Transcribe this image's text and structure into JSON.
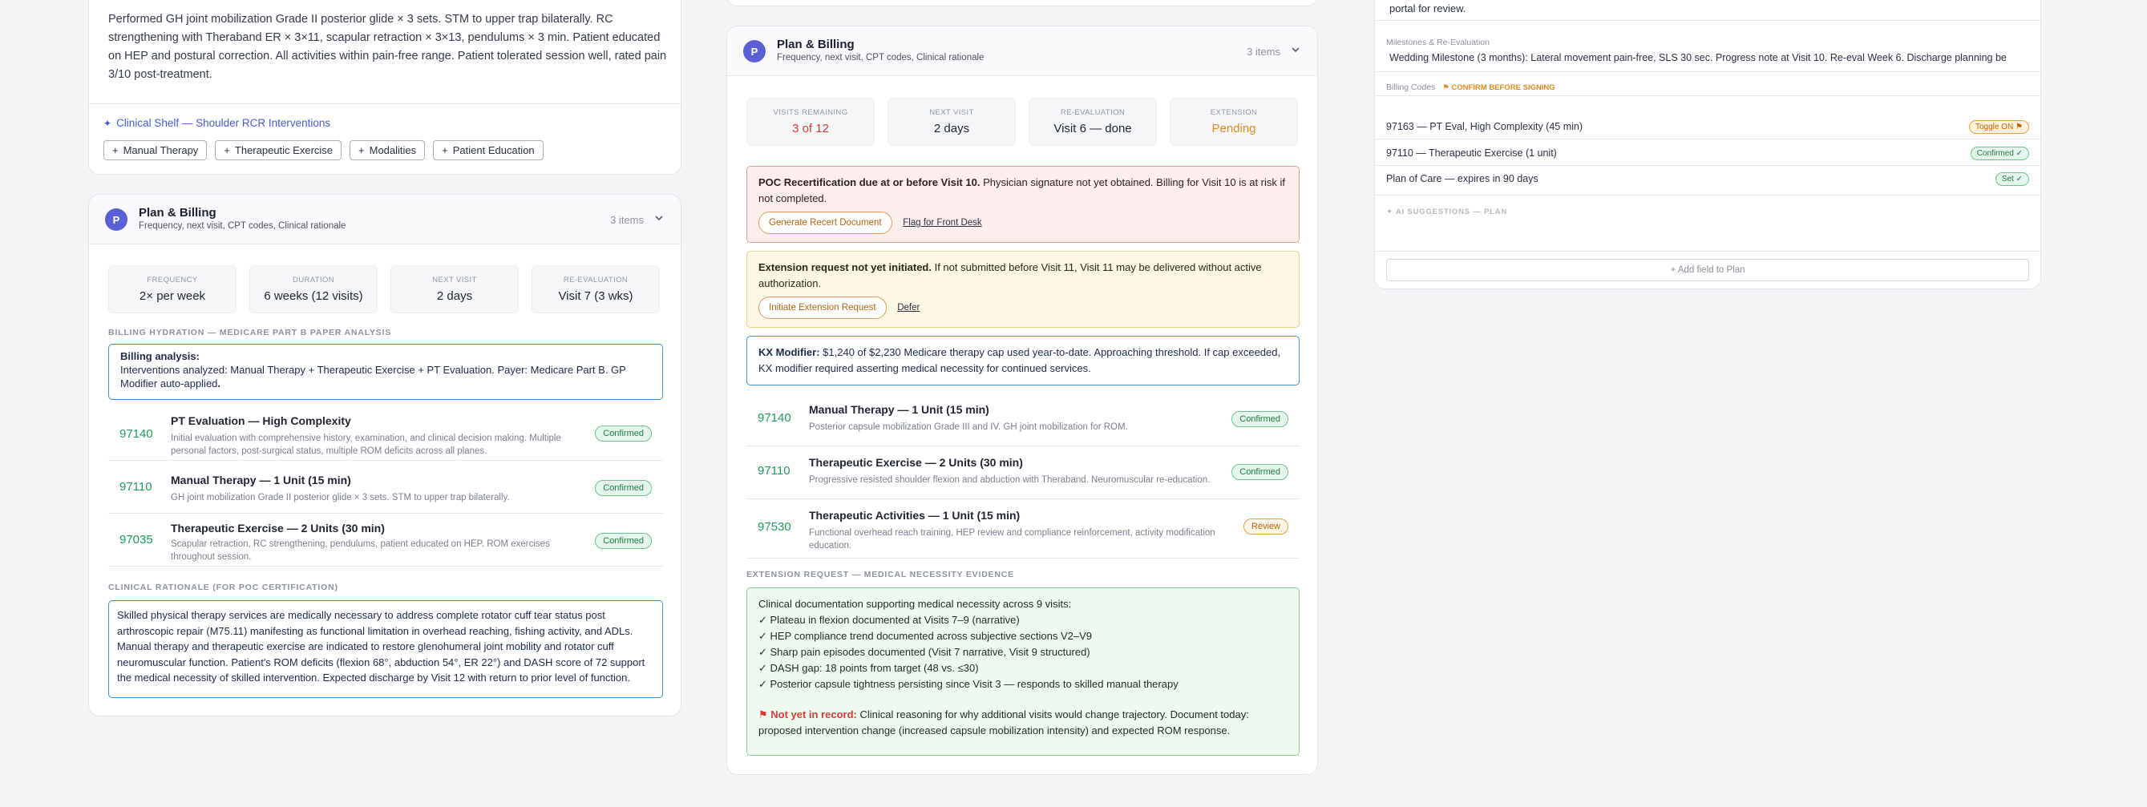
{
  "top_note": {
    "text": "Performed GH joint mobilization Grade II posterior glide × 3 sets. STM to upper trap bilaterally. RC strengthening with Theraband ER × 3×11, scapular retraction × 3×13, pendulums × 3 min. Patient educated on HEP and postural correction. All activities within pain-free range. Patient tolerated session well, rated pain 3/10 post-treatment.",
    "shelf_label": "Clinical Shelf — Shoulder RCR Interventions",
    "chips": [
      "Manual Therapy",
      "Therapeutic Exercise",
      "Modalities",
      "Patient Education"
    ]
  },
  "plan_left": {
    "avatar": "P",
    "title": "Plan & Billing",
    "subtitle": "Frequency, next visit, CPT codes, Clinical rationale",
    "count": "3 items",
    "stats": [
      {
        "label": "FREQUENCY",
        "value": "2× per week"
      },
      {
        "label": "DURATION",
        "value": "6 weeks (12 visits)"
      },
      {
        "label": "NEXT VISIT",
        "value": "2 days"
      },
      {
        "label": "RE-EVALUATION",
        "value": "Visit 7 (3 wks)"
      }
    ],
    "hydration_label": "BILLING HYDRATION — MEDICARE PART B PAPER ANALYSIS",
    "analysis_title": "Billing analysis:",
    "analysis_text": "Interventions analyzed: Manual Therapy + Therapeutic Exercise + PT Evaluation. Payer: Medicare Part B. GP Modifier auto-applied",
    "analysis_end": ".",
    "codes": [
      {
        "code": "97140",
        "title": "PT Evaluation — High Complexity",
        "desc": "Initial evaluation with comprehensive history, examination, and clinical decision making. Multiple personal factors, post-surgical status, multiple ROM deficits across all planes.",
        "status": "Confirmed"
      },
      {
        "code": "97110",
        "title": "Manual Therapy — 1 Unit (15 min)",
        "desc": "GH joint mobilization Grade II posterior glide × 3 sets. STM to upper trap bilaterally.",
        "status": "Confirmed"
      },
      {
        "code": "97035",
        "title": "Therapeutic Exercise — 2 Units (30 min)",
        "desc": "Scapular retraction, RC strengthening, pendulums, patient educated on HEP. ROM exercises throughout session.",
        "status": "Confirmed"
      }
    ],
    "rationale_label": "CLINICAL RATIONALE (FOR POC CERTIFICATION)",
    "rationale_text": "Skilled physical therapy services are medically necessary to address complete rotator cuff tear status post arthroscopic repair (M75.11) manifesting as functional limitation in overhead reaching, fishing activity, and ADLs. Manual therapy and therapeutic exercise are indicated to restore glenohumeral joint mobility and rotator cuff neuromuscular function. Patient's ROM deficits (flexion 68°, abduction 54°, ER 22°) and DASH score of 72 support the medical necessity of skilled intervention. Expected discharge by Visit 12 with return to prior level of function."
  },
  "plan_mid": {
    "avatar": "P",
    "title": "Plan & Billing",
    "subtitle": "Frequency, next visit, CPT codes, Clinical rationale",
    "count": "3 items",
    "stats": [
      {
        "label": "VISITS REMAINING",
        "value": "3 of 12"
      },
      {
        "label": "NEXT VISIT",
        "value": "2 days"
      },
      {
        "label": "RE-EVALUATION",
        "value": "Visit 6 — done"
      },
      {
        "label": "EXTENSION",
        "value": "Pending"
      }
    ],
    "poc_title": "POC Recertification due at or before Visit 10.",
    "poc_text": " Physician signature not yet obtained. Billing for Visit 10 is at risk if not completed.",
    "poc_button": "Generate Recert Document",
    "poc_link": "Flag for Front Desk",
    "ext_title": "Extension request not yet initiated.",
    "ext_text": " If not submitted before Visit 11, Visit 11 may be delivered without active authorization.",
    "ext_button": "Initiate Extension Request",
    "ext_link": "Defer",
    "kx_title": "KX Modifier:",
    "kx_text": " $1,240 of $2,230 Medicare therapy cap used year-to-date. Approaching threshold. If cap exceeded, KX modifier required asserting medical necessity for continued services.",
    "codes": [
      {
        "code": "97140",
        "title": "Manual Therapy — 1 Unit (15 min)",
        "desc": "Posterior capsule mobilization Grade III and IV. GH joint mobilization for ROM.",
        "status": "Confirmed"
      },
      {
        "code": "97110",
        "title": "Therapeutic Exercise — 2 Units (30 min)",
        "desc": "Progressive resisted shoulder flexion and abduction with Theraband. Neuromuscular re-education.",
        "status": "Confirmed"
      },
      {
        "code": "97530",
        "title": "Therapeutic Activities — 1 Unit (15 min)",
        "desc": "Functional overhead reach training, HEP review and compliance reinforcement, activity modification education.",
        "status": "Review"
      }
    ],
    "evidence_label": "EXTENSION REQUEST — MEDICAL NECESSITY EVIDENCE",
    "evidence_intro": "Clinical documentation supporting medical necessity across 9 visits:",
    "evidence_items": [
      "✓ Plateau in flexion documented at Visits 7–9 (narrative)",
      "✓ HEP compliance trend documented across subjective sections V2–V9",
      "✓ Sharp pain episodes documented (Visit 7 narrative, Visit 9 structured)",
      "✓ DASH gap: 18 points from target (48 vs. ≤30)",
      "✓ Posterior capsule tightness persisting since Visit 3 — responds to skilled manual therapy"
    ],
    "not_in_record_label": "⚑ Not yet in record:",
    "not_in_record_text": " Clinical reasoning for why additional visits would change trajectory. Document today: proposed intervention change (increased capsule mobilization intensity) and expected ROM response."
  },
  "right_panel": {
    "portal_text": "portal for review.",
    "milestones_label": "Milestones & Re-Evaluation",
    "milestones_text": "Wedding Milestone (3 months): Lateral movement pain-free, SLS 30 sec. Progress note at Visit 10. Re-eval Week 6. Discharge planning be",
    "billing_label": "Billing Codes",
    "billing_warn": "⚑ CONFIRM BEFORE SIGNING",
    "billing_rows": [
      {
        "text": "97163 — PT Eval, High Complexity (45 min)",
        "chip": "Toggle ON ⚑"
      },
      {
        "text": "97110 — Therapeutic Exercise (1 unit)",
        "chip": "Confirmed ✓"
      },
      {
        "text": "Plan of Care — expires in 90 days",
        "chip": "Set ✓"
      }
    ],
    "ai_label": "✦ AI SUGGESTIONS — PLAN",
    "add_field": "+ Add field to Plan"
  },
  "colors": {
    "accent": "#5b5fd6",
    "green": "#1f9b5a",
    "danger": "#d63a3a",
    "warning": "#e08a1e",
    "info_border": "#3a8fd6"
  }
}
